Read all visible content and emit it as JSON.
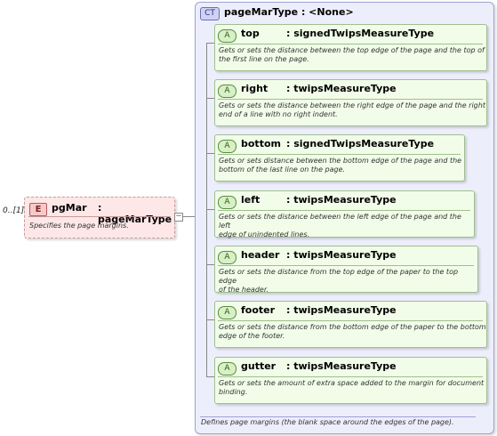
{
  "element": {
    "occurs": "0..[1]",
    "badge": "E",
    "name": "pgMar",
    "type": ": pageMarType",
    "doc": "Specifies the page margins."
  },
  "complex_type": {
    "badge": "CT",
    "title": "pageMarType : <None>",
    "doc": "Defines page margins (the blank space around the edges of the page)."
  },
  "attributes": [
    {
      "badge": "A",
      "name": "top",
      "type": ": signedTwipsMeasureType",
      "doc1": "Gets or sets the distance between the top edge of the page and the top of",
      "doc2": "the first line on the page."
    },
    {
      "badge": "A",
      "name": "right",
      "type": ": twipsMeasureType",
      "doc1": "Gets or sets the distance between the right edge of the page and the right",
      "doc2": "end of a line with no right indent."
    },
    {
      "badge": "A",
      "name": "bottom",
      "type": ": signedTwipsMeasureType",
      "doc1": "Gets or sets distance between the bottom edge of the page and the",
      "doc2": "bottom of the last line on the page."
    },
    {
      "badge": "A",
      "name": "left",
      "type": ": twipsMeasureType",
      "doc1": "Gets or sets the distance between the left edge of the page and the left",
      "doc2": "edge of unindented lines."
    },
    {
      "badge": "A",
      "name": "header",
      "type": ": twipsMeasureType",
      "doc1": "Gets or sets the distance from the top edge of the paper to the top edge",
      "doc2": "of the header."
    },
    {
      "badge": "A",
      "name": "footer",
      "type": ": twipsMeasureType",
      "doc1": "Gets or sets the distance from the bottom edge of the paper to the bottom",
      "doc2": "edge of the footer."
    },
    {
      "badge": "A",
      "name": "gutter",
      "type": ": twipsMeasureType",
      "doc1": "Gets or sets the amount of extra space added to the margin for document",
      "doc2": "binding."
    }
  ]
}
